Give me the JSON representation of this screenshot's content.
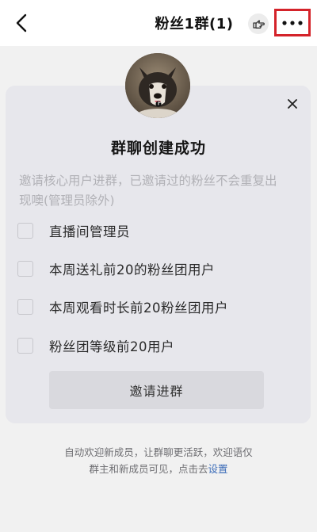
{
  "header": {
    "title": "粉丝1群(1)",
    "back_icon": "chevron-left-icon",
    "hand_icon": "pointing-hand-icon",
    "more_icon": "more-dots-icon",
    "highlight_color": "#d4232a"
  },
  "card": {
    "title": "群聊创建成功",
    "description": "邀请核心用户进群，已邀请过的粉丝不会重复出现噢(管理员除外)",
    "options": [
      {
        "label": "直播间管理员",
        "checked": false
      },
      {
        "label": "本周送礼前20的粉丝团用户",
        "checked": false
      },
      {
        "label": "本周观看时长前20粉丝团用户",
        "checked": false
      },
      {
        "label": "粉丝团等级前20用户",
        "checked": false
      }
    ],
    "invite_button": "邀请进群",
    "close_icon": "close-icon"
  },
  "footer": {
    "line1": "自动欢迎新成员，让群聊更活跃，欢迎语仅",
    "line2_prefix": "群主和新成员可见，点击去",
    "settings_link": "设置"
  }
}
